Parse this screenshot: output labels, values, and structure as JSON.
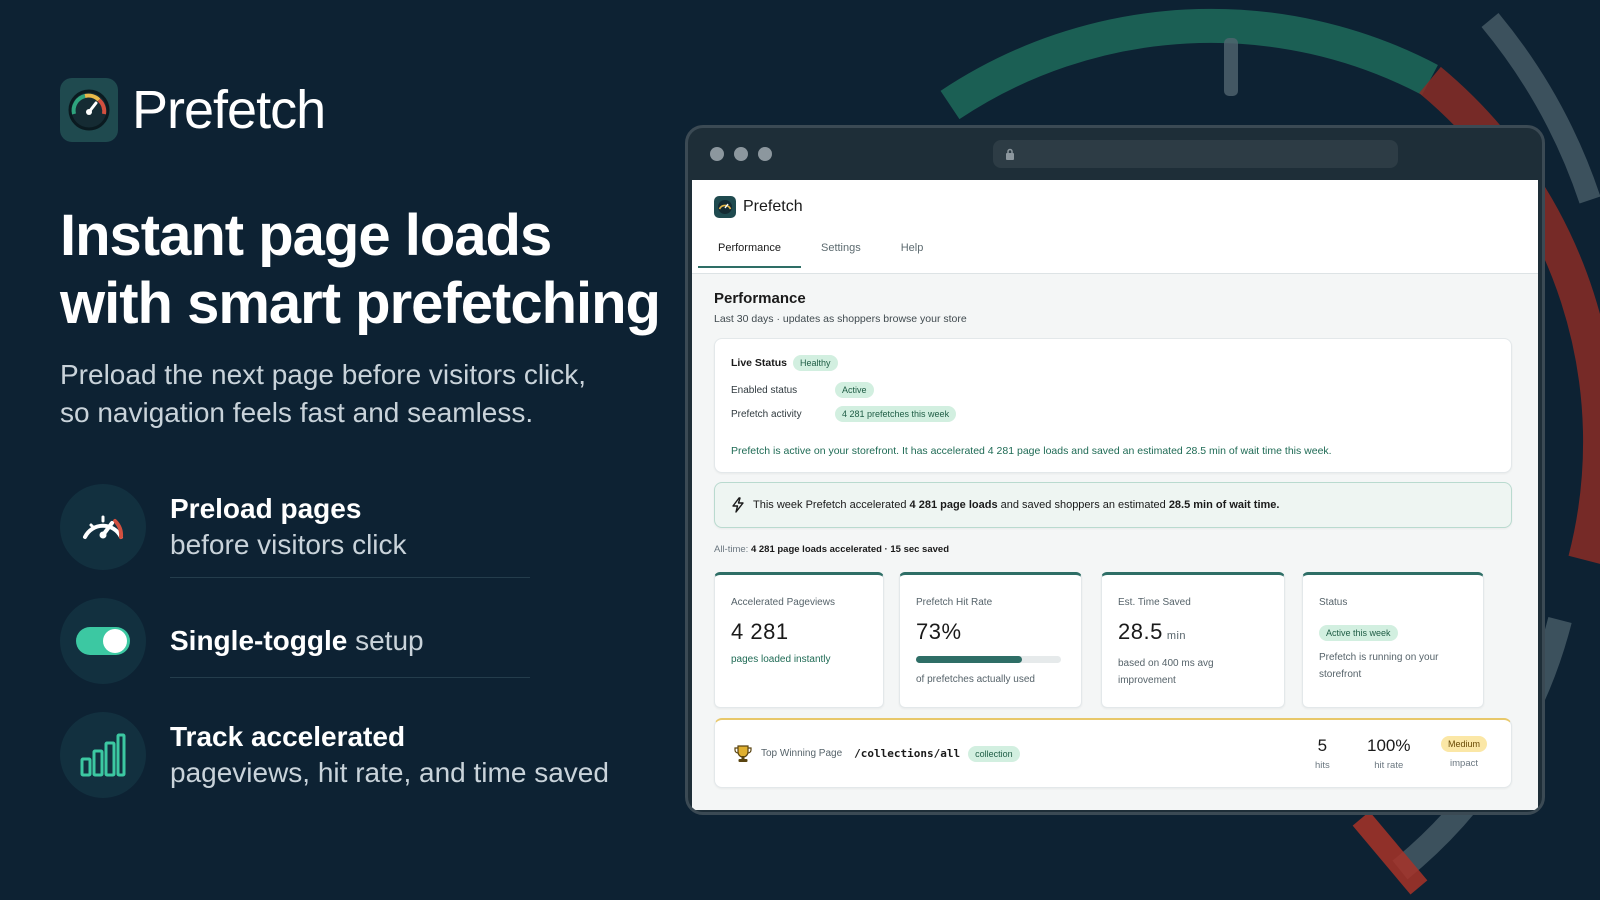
{
  "brand": {
    "name": "Prefetch"
  },
  "hero": {
    "headline_line1": "Instant page loads",
    "headline_line2": "with smart prefetching",
    "subhead_line1": "Preload the next page before visitors click,",
    "subhead_line2": "so navigation feels fast and seamless."
  },
  "features": [
    {
      "title": "Preload pages",
      "subtitle": "before visitors click",
      "icon": "speedometer-icon"
    },
    {
      "title": "Single-toggle",
      "title_rest": "setup",
      "icon": "toggle-icon"
    },
    {
      "title": "Track accelerated",
      "subtitle": "pageviews, hit rate, and time saved",
      "icon": "bar-chart-icon"
    }
  ],
  "app": {
    "brand_name": "Prefetch",
    "tabs": [
      "Performance",
      "Settings",
      "Help"
    ],
    "active_tab": "Performance",
    "section_title": "Performance",
    "section_sub": "Last 30 days · updates as shoppers browse your store",
    "live_status": {
      "title": "Live Status",
      "badge": "Healthy",
      "enabled_label": "Enabled status",
      "enabled_value": "Active",
      "activity_label": "Prefetch activity",
      "activity_value": "4 281 prefetches this week",
      "message": "Prefetch is active on your storefront. It has accelerated 4 281 page loads and saved an estimated 28.5 min of wait time this week."
    },
    "banner": {
      "pre": "This week Prefetch accelerated",
      "loads": "4 281 page loads",
      "mid": "and saved shoppers an estimated",
      "saved": "28.5 min of wait time."
    },
    "alltime": {
      "label": "All-time:",
      "value": "4 281 page loads accelerated · 15 sec saved"
    },
    "stats": {
      "pageviews": {
        "label": "Accelerated Pageviews",
        "value": "4 281",
        "note": "pages loaded instantly"
      },
      "hit_rate": {
        "label": "Prefetch Hit Rate",
        "value": "73%",
        "fraction": 0.73,
        "note": "of prefetches actually used"
      },
      "time_saved": {
        "label": "Est. Time Saved",
        "value": "28.5",
        "unit": "min",
        "note1": "based on 400 ms avg",
        "note2": "improvement"
      },
      "status": {
        "label": "Status",
        "badge": "Active this week",
        "note1": "Prefetch is running on your",
        "note2": "storefront"
      }
    },
    "top_page": {
      "label": "Top Winning Page",
      "path": "/collections/all",
      "tag": "collection",
      "hits_value": "5",
      "hits_label": "hits",
      "rate_value": "100%",
      "rate_label": "hit rate",
      "impact_value": "Medium",
      "impact_label": "impact"
    }
  },
  "colors": {
    "background": "#0d2233",
    "accent": "#2e6e66",
    "toggle": "#3cc8a2",
    "gauge_red": "#c0392b",
    "gauge_green": "#1f8a6c"
  }
}
